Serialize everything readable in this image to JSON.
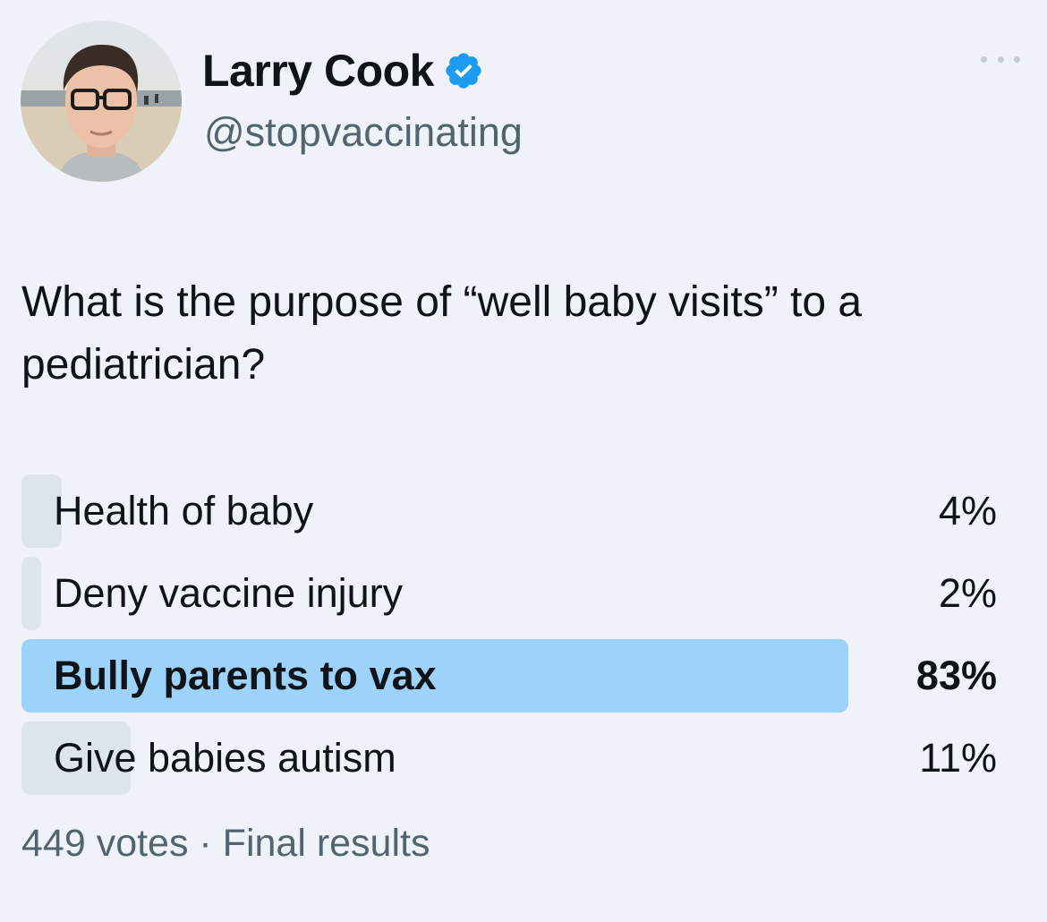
{
  "author": {
    "display_name": "Larry Cook",
    "handle": "@stopvaccinating",
    "verified_icon": "verified-badge-icon"
  },
  "more_icon": "more-horizontal-icon",
  "question": "What is the purpose of “well baby visits” to a pediatrician?",
  "poll": {
    "options": [
      {
        "label": "Health of baby",
        "percent_text": "4%",
        "percent": 4,
        "winner": false
      },
      {
        "label": "Deny vaccine injury",
        "percent_text": "2%",
        "percent": 2,
        "winner": false
      },
      {
        "label": "Bully parents to vax",
        "percent_text": "83%",
        "percent": 83,
        "winner": true
      },
      {
        "label": "Give babies autism",
        "percent_text": "11%",
        "percent": 11,
        "winner": false
      }
    ],
    "footer": "449 votes · Final results"
  },
  "colors": {
    "background": "#eff3f9",
    "bar": "#dde4ec",
    "winner_bar": "#9dd2fa",
    "verified": "#1d9bf0",
    "secondary_text": "#536471"
  }
}
